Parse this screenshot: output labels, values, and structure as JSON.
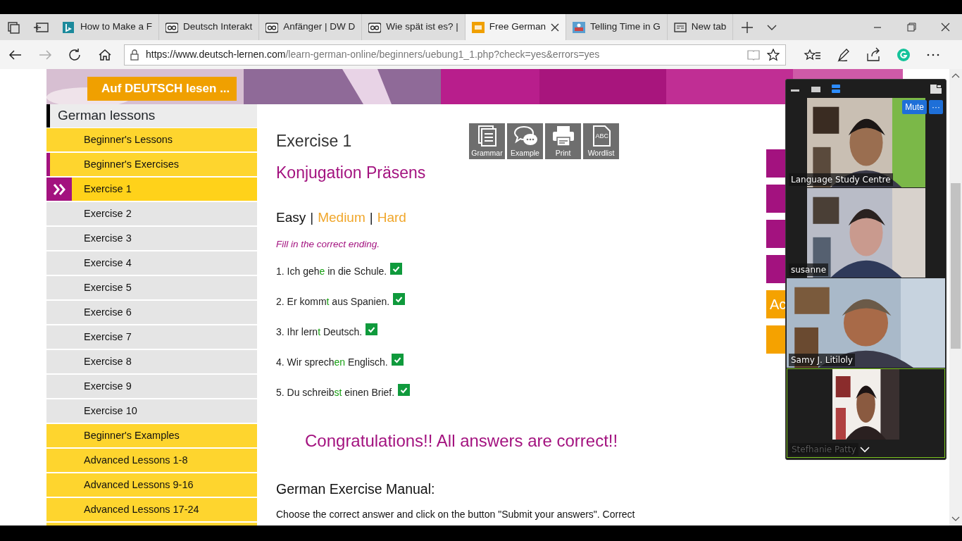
{
  "browser": {
    "tabs": [
      {
        "label": "How to Make a F",
        "selected": false
      },
      {
        "label": "Deutsch Interakt",
        "selected": false
      },
      {
        "label": "Anfänger | DW D",
        "selected": false
      },
      {
        "label": "Wie spät ist es? |",
        "selected": false
      },
      {
        "label": "Free German",
        "selected": true
      },
      {
        "label": "Telling Time in G",
        "selected": false
      },
      {
        "label": "New tab",
        "selected": false
      }
    ],
    "url": {
      "host": "https://www.deutsch-lernen.com",
      "path": "/learn-german-online/beginners/uebung1_1.php?check=yes&errors=yes"
    },
    "forward_disabled": true
  },
  "page": {
    "banner_button": "Auf DEUTSCH lesen ...",
    "sidebar": {
      "title": "German lessons",
      "items": [
        {
          "label": "Beginner's Lessons",
          "kind": "section",
          "selected": false,
          "expanded": false
        },
        {
          "label": "Beginner's Exercises",
          "kind": "section",
          "selected": false,
          "expanded": true
        },
        {
          "label": "Exercise 1",
          "kind": "sub",
          "selected": true,
          "expanded": false
        },
        {
          "label": "Exercise 2",
          "kind": "sub",
          "selected": false,
          "expanded": false
        },
        {
          "label": "Exercise 3",
          "kind": "sub",
          "selected": false,
          "expanded": false
        },
        {
          "label": "Exercise 4",
          "kind": "sub",
          "selected": false,
          "expanded": false
        },
        {
          "label": "Exercise 5",
          "kind": "sub",
          "selected": false,
          "expanded": false
        },
        {
          "label": "Exercise 6",
          "kind": "sub",
          "selected": false,
          "expanded": false
        },
        {
          "label": "Exercise 7",
          "kind": "sub",
          "selected": false,
          "expanded": false
        },
        {
          "label": "Exercise 8",
          "kind": "sub",
          "selected": false,
          "expanded": false
        },
        {
          "label": "Exercise 9",
          "kind": "sub",
          "selected": false,
          "expanded": false
        },
        {
          "label": "Exercise 10",
          "kind": "sub",
          "selected": false,
          "expanded": false
        },
        {
          "label": "Beginner's Examples",
          "kind": "section",
          "selected": false,
          "expanded": false
        },
        {
          "label": "Advanced Lessons 1-8",
          "kind": "section",
          "selected": false,
          "expanded": false
        },
        {
          "label": "Advanced Lessons 9-16",
          "kind": "section",
          "selected": false,
          "expanded": false
        },
        {
          "label": "Advanced Lessons 17-24",
          "kind": "section",
          "selected": false,
          "expanded": false
        }
      ]
    },
    "exercise": {
      "title": "Exercise 1",
      "subtitle": "Konjugation Präsens",
      "tools": [
        {
          "label": "Grammar",
          "kind": "grammar"
        },
        {
          "label": "Example",
          "kind": "example"
        },
        {
          "label": "Print",
          "kind": "print"
        },
        {
          "label": "Wordlist",
          "kind": "wordlist",
          "glyph": "ABC"
        }
      ],
      "levels": [
        {
          "label": "Easy",
          "selected": true
        },
        {
          "separator": "|",
          "label": "Medium",
          "selected": false
        },
        {
          "separator": "|",
          "label": "Hard",
          "selected": false
        }
      ],
      "instruction": "Fill in the correct ending.",
      "items": [
        {
          "before": "1. Ich geh",
          "ending": "e",
          "after": " in die Schule.",
          "correct": true
        },
        {
          "before": "2. Er komm",
          "ending": "t",
          "after": " aus Spanien.",
          "correct": true
        },
        {
          "before": "3. Ihr lern",
          "ending": "t",
          "after": " Deutsch.",
          "correct": true
        },
        {
          "before": "4. Wir sprech",
          "ending": "en",
          "after": " Englisch.",
          "correct": true
        },
        {
          "before": "5. Du schreib",
          "ending": "st",
          "after": " einen Brief.",
          "correct": true
        }
      ],
      "result": "Congratulations!! All answers are correct!!",
      "manual_title": "German Exercise Manual:",
      "manual_text": "Choose the correct answer and click on the button \"Submit your answers\". Correct"
    },
    "side_boxes": [
      {
        "color": "#a3127f"
      },
      {
        "color": "#a3127f"
      },
      {
        "color": "#a3127f"
      },
      {
        "color": "#a3127f"
      },
      {
        "color": "#f5a200",
        "text": "Ac"
      },
      {
        "color": "#f5a200"
      }
    ]
  },
  "meeting": {
    "view_buttons": [
      {
        "kind": "minimize",
        "selected": false
      },
      {
        "kind": "gallery",
        "selected": false
      },
      {
        "kind": "speaker",
        "selected": true
      }
    ],
    "mute_button": "Mute",
    "more_button": "···",
    "tiles": [
      {
        "name": "Language Study Centre",
        "kind": "narrow",
        "active": false
      },
      {
        "name": "susanne",
        "kind": "narrow",
        "active": false
      },
      {
        "name": "Samy J. Litiloly",
        "kind": "wide",
        "active": false
      },
      {
        "name": "Stefhanie Patty",
        "kind": "tiny",
        "active": true
      }
    ]
  }
}
